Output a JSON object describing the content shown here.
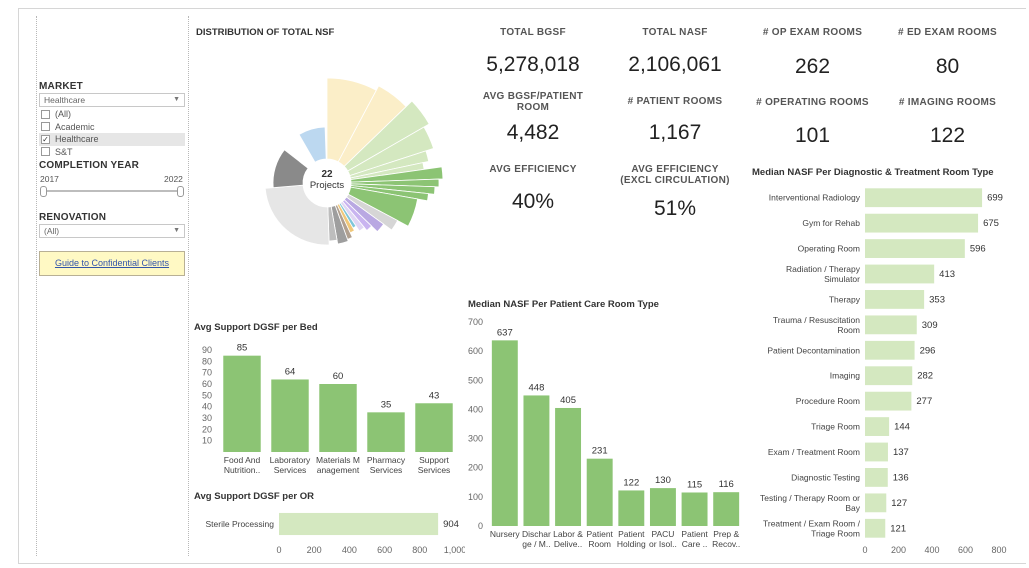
{
  "filters": {
    "market": {
      "title": "MARKET",
      "selected": "Healthcare",
      "options": [
        {
          "label": "(All)",
          "checked": false
        },
        {
          "label": "Academic",
          "checked": false
        },
        {
          "label": "Healthcare",
          "checked": true
        },
        {
          "label": "S&T",
          "checked": false
        }
      ]
    },
    "completion_year": {
      "title": "COMPLETION YEAR",
      "min_label": "2017",
      "max_label": "2022"
    },
    "renovation": {
      "title": "RENOVATION",
      "selected": "(All)"
    },
    "guide_link": "Guide to Confidential Clients"
  },
  "donut": {
    "title": "DISTRIBUTION OF TOTAL NSF",
    "center_count": "22",
    "center_label": "Projects"
  },
  "kpis": {
    "total_bgsf": {
      "label": "TOTAL BGSF",
      "value": "5,278,018"
    },
    "total_nasf": {
      "label": "TOTAL NASF",
      "value": "2,106,061"
    },
    "op_exam_rooms": {
      "label": "# OP EXAM ROOMS",
      "value": "262"
    },
    "ed_exam_rooms": {
      "label": "# ED EXAM ROOMS",
      "value": "80"
    },
    "avg_bgsf_patient_room": {
      "label": "AVG BGSF/PATIENT ROOM",
      "value": "4,482"
    },
    "patient_rooms": {
      "label": "# PATIENT ROOMS",
      "value": "1,167"
    },
    "operating_rooms": {
      "label": "# OPERATING ROOMS",
      "value": "101"
    },
    "imaging_rooms": {
      "label": "# IMAGING ROOMS",
      "value": "122"
    },
    "avg_efficiency": {
      "label": "AVG EFFICIENCY",
      "value": "40%"
    },
    "avg_efficiency_excl": {
      "label": "AVG EFFICIENCY (EXCL CIRCULATION)",
      "value": "51%"
    }
  },
  "colors": {
    "bar": "#8cc474",
    "bar_light": "#d4e8c0"
  },
  "chart_data": [
    {
      "id": "support_bed",
      "type": "bar",
      "title": "Avg Support DGSF per Bed",
      "categories": [
        [
          "Food And",
          "Nutrition.."
        ],
        [
          "Laboratory",
          "Services"
        ],
        [
          "Materials M",
          "anagement"
        ],
        [
          "Pharmacy",
          "Services"
        ],
        [
          "Support",
          "Services"
        ]
      ],
      "values": [
        85,
        64,
        60,
        35,
        43
      ],
      "yticks": [
        10,
        20,
        30,
        40,
        50,
        60,
        70,
        80,
        90
      ],
      "ylim": [
        0,
        90
      ]
    },
    {
      "id": "support_or",
      "type": "bar",
      "orientation": "horizontal",
      "title": "Avg Support DGSF per OR",
      "categories": [
        "Sterile Processing"
      ],
      "values": [
        904
      ],
      "xticks": [
        "0",
        "200",
        "400",
        "600",
        "800",
        "1,000"
      ],
      "xlim": [
        0,
        1000
      ]
    },
    {
      "id": "patient_care",
      "type": "bar",
      "title": "Median NASF Per Patient Care Room Type",
      "categories": [
        [
          "Nursery"
        ],
        [
          "Dischar",
          "ge / M.."
        ],
        [
          "Labor &",
          "Delive.."
        ],
        [
          "Patient",
          "Room"
        ],
        [
          "Patient",
          "Holding"
        ],
        [
          "PACU",
          "or Isol.."
        ],
        [
          "Patient",
          "Care .."
        ],
        [
          "Prep &",
          "Recov.."
        ]
      ],
      "values": [
        637,
        448,
        405,
        231,
        122,
        130,
        115,
        116
      ],
      "yticks": [
        0,
        100,
        200,
        300,
        400,
        500,
        600,
        700
      ],
      "ylim": [
        0,
        700
      ]
    },
    {
      "id": "diag_treat",
      "type": "bar",
      "orientation": "horizontal",
      "title": "Median NASF Per Diagnostic & Treatment Room Type",
      "categories": [
        [
          "Interventional Radiology"
        ],
        [
          "Gym for Rehab"
        ],
        [
          "Operating Room"
        ],
        [
          "Radiation / Therapy",
          "Simulator"
        ],
        [
          "Therapy"
        ],
        [
          "Trauma / Resuscitation",
          "Room"
        ],
        [
          "Patient Decontamination"
        ],
        [
          "Imaging"
        ],
        [
          "Procedure Room"
        ],
        [
          "Triage Room"
        ],
        [
          "Exam / Treatment Room"
        ],
        [
          "Diagnostic Testing"
        ],
        [
          "Testing / Therapy Room or",
          "Bay"
        ],
        [
          "Treatment / Exam Room /",
          "Triage Room"
        ]
      ],
      "values": [
        699,
        675,
        596,
        413,
        353,
        309,
        296,
        282,
        277,
        144,
        137,
        136,
        127,
        121
      ],
      "xticks": [
        0,
        200,
        400,
        600,
        800
      ],
      "xlim": [
        0,
        800
      ]
    }
  ]
}
